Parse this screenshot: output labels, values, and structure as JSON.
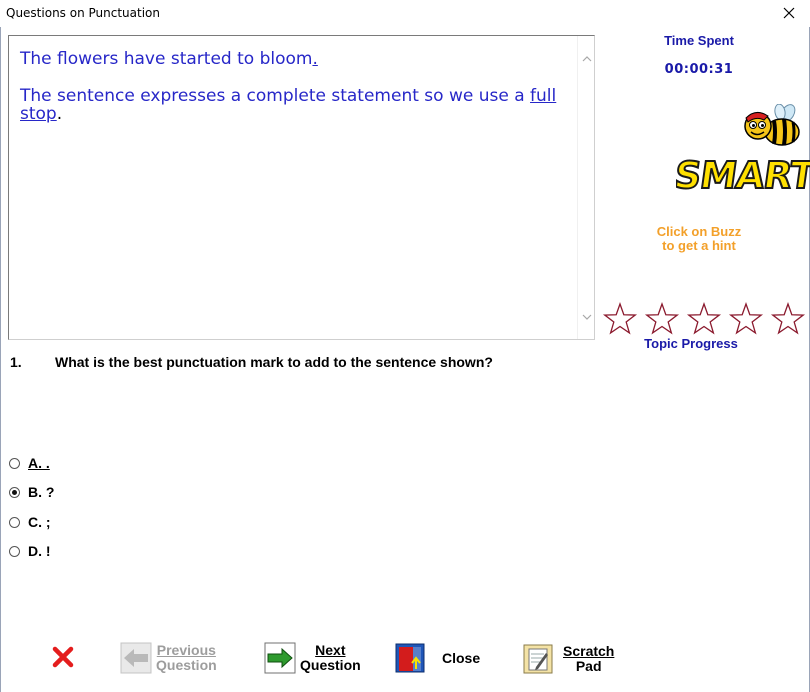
{
  "window": {
    "title": "Questions on Punctuation"
  },
  "passage": {
    "sentence_text": "The flowers have started to bloom",
    "sentence_mark": ".",
    "explanation_text": "The sentence expresses a complete statement so we use a ",
    "explanation_link": "full stop",
    "explanation_end": "."
  },
  "timer": {
    "label": "Time Spent",
    "value": "00:00:31"
  },
  "logo": {
    "text": "SMART"
  },
  "hint": {
    "line1": "Click on Buzz",
    "line2": "to get a hint"
  },
  "progress": {
    "label": "Topic Progress",
    "stars_total": 5,
    "stars_filled": 0
  },
  "question": {
    "number": "1.",
    "text": "What is the best punctuation mark to add to the sentence shown?"
  },
  "options": [
    {
      "label": "A. .",
      "selected": false
    },
    {
      "label": "B. ?",
      "selected": true
    },
    {
      "label": "C. ;",
      "selected": false
    },
    {
      "label": "D. !",
      "selected": false
    }
  ],
  "buttons": {
    "previous_line1": "Previous",
    "previous_line2": "Question",
    "next_line1": "Next",
    "next_line2": "Question",
    "close": "Close",
    "scratch_line1": "Scratch",
    "scratch_line2": "Pad"
  },
  "colors": {
    "text_blue": "#2727c8",
    "heading_blue": "#1a1aa8",
    "hint_orange": "#f3a02a",
    "star_outline": "#8b1a2e",
    "wrong_red": "#e41d1d"
  }
}
